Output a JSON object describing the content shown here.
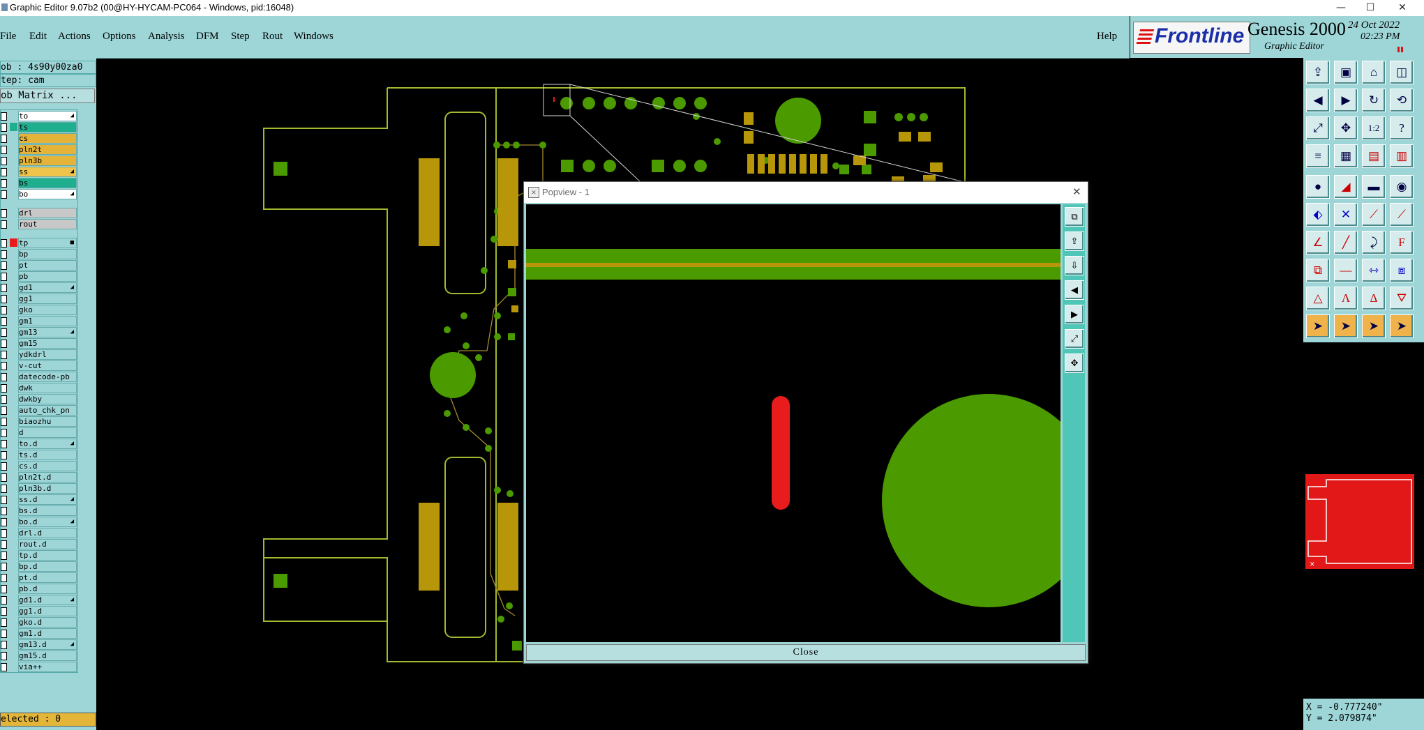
{
  "window": {
    "title": "Graphic Editor 9.07b2 (00@HY-HYCAM-PC064 - Windows, pid:16048)",
    "minimize": "—",
    "maximize": "☐",
    "close": "✕"
  },
  "menu": {
    "items": [
      "File",
      "Edit",
      "Actions",
      "Options",
      "Analysis",
      "DFM",
      "Step",
      "Rout",
      "Windows"
    ],
    "help": "Help"
  },
  "branding": {
    "logo": "Frontline",
    "product": "Genesis 2000",
    "subtitle": "Graphic Editor",
    "date": "24 Oct 2022",
    "time": "02:23 PM"
  },
  "job": {
    "job_label": "ob : 4s90y00za0",
    "step_label": "tep: cam",
    "matrix_button": "ob Matrix ..."
  },
  "layers": [
    {
      "name": "to",
      "color": "#ffffff",
      "mark": "◢"
    },
    {
      "name": "ts",
      "color": "#1fae8e",
      "mark": ""
    },
    {
      "name": "cs",
      "color": "#e4b43a",
      "mark": ""
    },
    {
      "name": "pln2t",
      "color": "#e4b43a",
      "mark": ""
    },
    {
      "name": "pln3b",
      "color": "#e4b43a",
      "mark": ""
    },
    {
      "name": "ss",
      "color": "#f0c44a",
      "mark": "◢"
    },
    {
      "name": "bs",
      "color": "#1fae8e",
      "mark": ""
    },
    {
      "name": "bo",
      "color": "#ffffff",
      "mark": "◢"
    },
    {
      "name": "drl",
      "color": "#c8c8c8",
      "mark": ""
    },
    {
      "name": "rout",
      "color": "#c8c8c8",
      "mark": ""
    },
    {
      "name": "tp",
      "color": "#9ed6d8",
      "mark": "■"
    },
    {
      "name": "bp",
      "color": "#9ed6d8",
      "mark": ""
    },
    {
      "name": "pt",
      "color": "#9ed6d8",
      "mark": ""
    },
    {
      "name": "pb",
      "color": "#9ed6d8",
      "mark": ""
    },
    {
      "name": "gd1",
      "color": "#9ed6d8",
      "mark": "◢"
    },
    {
      "name": "gg1",
      "color": "#9ed6d8",
      "mark": ""
    },
    {
      "name": "gko",
      "color": "#9ed6d8",
      "mark": ""
    },
    {
      "name": "gm1",
      "color": "#9ed6d8",
      "mark": ""
    },
    {
      "name": "gm13",
      "color": "#9ed6d8",
      "mark": "◢"
    },
    {
      "name": "gm15",
      "color": "#9ed6d8",
      "mark": ""
    },
    {
      "name": "ydkdrl",
      "color": "#9ed6d8",
      "mark": ""
    },
    {
      "name": "v-cut",
      "color": "#9ed6d8",
      "mark": ""
    },
    {
      "name": "datecode-pb",
      "color": "#9ed6d8",
      "mark": ""
    },
    {
      "name": "dwk",
      "color": "#9ed6d8",
      "mark": ""
    },
    {
      "name": "dwkby",
      "color": "#9ed6d8",
      "mark": ""
    },
    {
      "name": "auto_chk_pn",
      "color": "#9ed6d8",
      "mark": ""
    },
    {
      "name": "biaozhu",
      "color": "#9ed6d8",
      "mark": ""
    },
    {
      "name": "d",
      "color": "#9ed6d8",
      "mark": ""
    },
    {
      "name": "to.d",
      "color": "#9ed6d8",
      "mark": "◢"
    },
    {
      "name": "ts.d",
      "color": "#9ed6d8",
      "mark": ""
    },
    {
      "name": "cs.d",
      "color": "#9ed6d8",
      "mark": ""
    },
    {
      "name": "pln2t.d",
      "color": "#9ed6d8",
      "mark": ""
    },
    {
      "name": "pln3b.d",
      "color": "#9ed6d8",
      "mark": ""
    },
    {
      "name": "ss.d",
      "color": "#9ed6d8",
      "mark": "◢"
    },
    {
      "name": "bs.d",
      "color": "#9ed6d8",
      "mark": ""
    },
    {
      "name": "bo.d",
      "color": "#9ed6d8",
      "mark": "◢"
    },
    {
      "name": "drl.d",
      "color": "#9ed6d8",
      "mark": ""
    },
    {
      "name": "rout.d",
      "color": "#9ed6d8",
      "mark": ""
    },
    {
      "name": "tp.d",
      "color": "#9ed6d8",
      "mark": ""
    },
    {
      "name": "bp.d",
      "color": "#9ed6d8",
      "mark": ""
    },
    {
      "name": "pt.d",
      "color": "#9ed6d8",
      "mark": ""
    },
    {
      "name": "pb.d",
      "color": "#9ed6d8",
      "mark": ""
    },
    {
      "name": "gd1.d",
      "color": "#9ed6d8",
      "mark": "◢"
    },
    {
      "name": "gg1.d",
      "color": "#9ed6d8",
      "mark": ""
    },
    {
      "name": "gko.d",
      "color": "#9ed6d8",
      "mark": ""
    },
    {
      "name": "gm1.d",
      "color": "#9ed6d8",
      "mark": ""
    },
    {
      "name": "gm13.d",
      "color": "#9ed6d8",
      "mark": "◢"
    },
    {
      "name": "gm15.d",
      "color": "#9ed6d8",
      "mark": ""
    },
    {
      "name": "via++",
      "color": "#9ed6d8",
      "mark": ""
    }
  ],
  "status": {
    "selected": "elected : 0"
  },
  "coordinates": {
    "x": "X = -0.777240\"",
    "y": "Y = 2.079874\""
  },
  "popview": {
    "title": "Popview - 1",
    "close_button": "Close",
    "close_x": "✕"
  },
  "colors": {
    "panel": "#9ed6d8",
    "pad_green": "#4a9a00",
    "pad_gold": "#b8960a",
    "outline": "#a5b82e",
    "highlight_red": "#e81c1c"
  }
}
